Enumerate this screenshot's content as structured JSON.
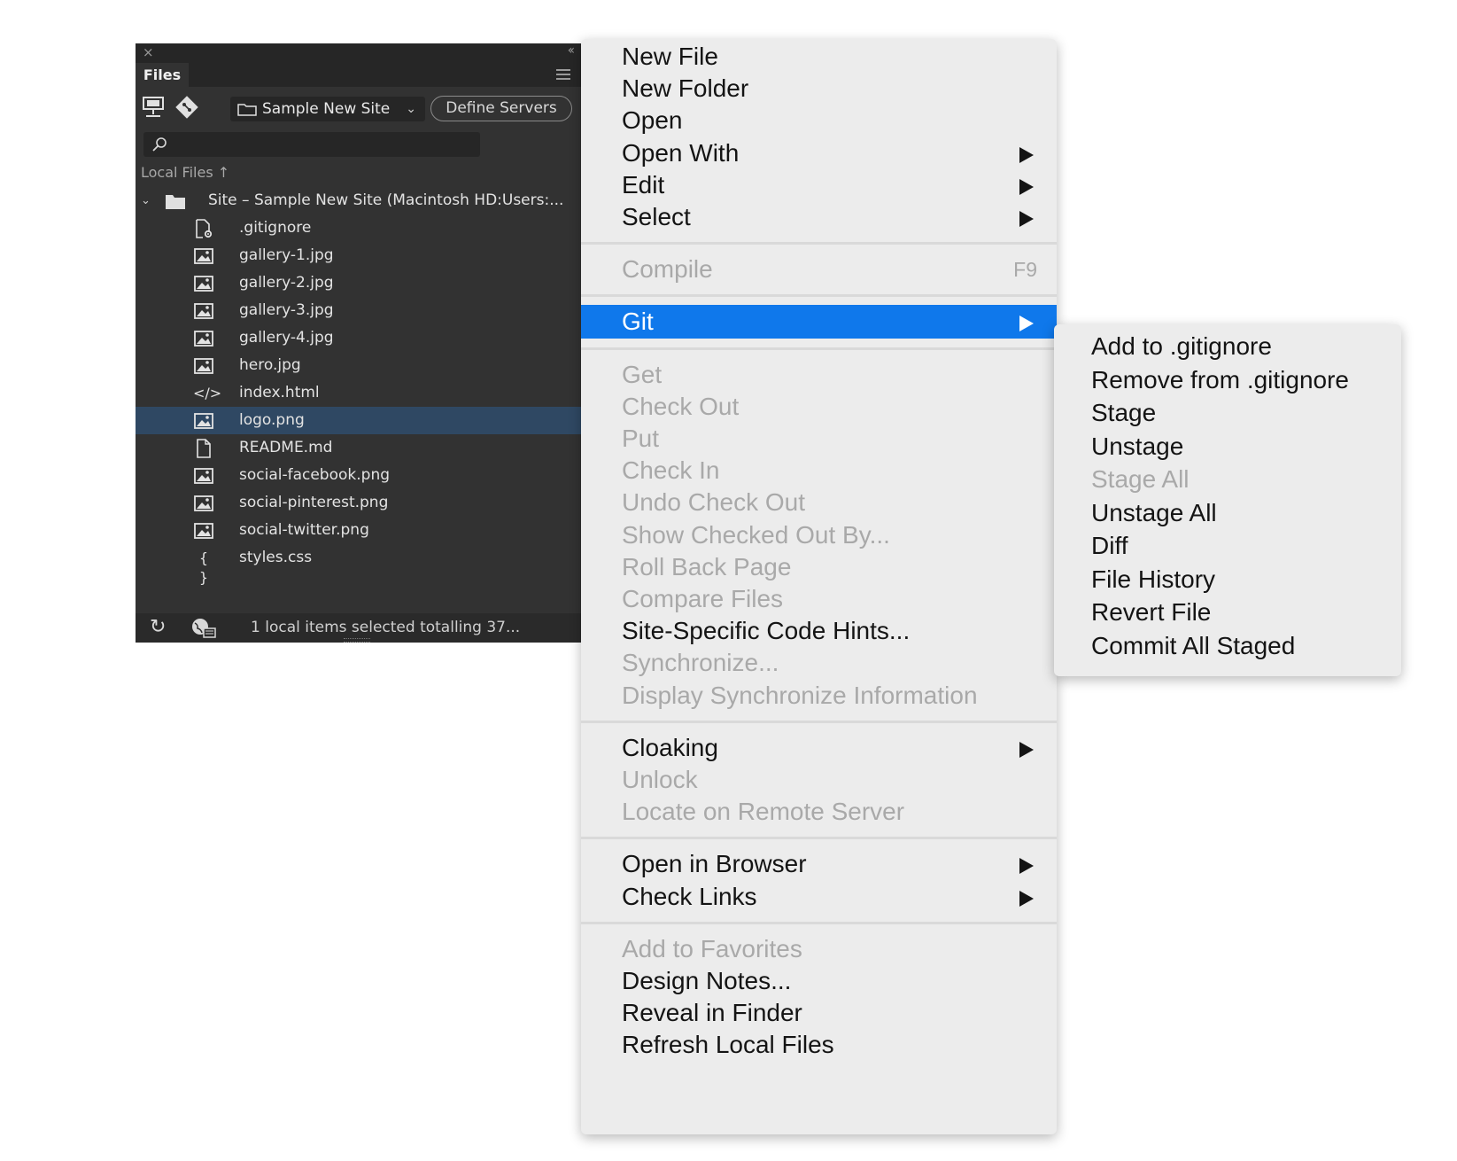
{
  "files_panel": {
    "close_glyph": "×",
    "collapse_glyph": "‹‹",
    "tab_label": "Files",
    "site_name": "Sample New Site",
    "define_servers_label": "Define Servers",
    "search_placeholder": "",
    "local_files_label": "Local Files",
    "root_label": "Site – Sample New Site (Macintosh HD:Users:...",
    "files": [
      {
        "name": ".gitignore",
        "icon": "file-gear-icon"
      },
      {
        "name": "gallery-1.jpg",
        "icon": "image-icon"
      },
      {
        "name": "gallery-2.jpg",
        "icon": "image-icon"
      },
      {
        "name": "gallery-3.jpg",
        "icon": "image-icon"
      },
      {
        "name": "gallery-4.jpg",
        "icon": "image-icon"
      },
      {
        "name": "hero.jpg",
        "icon": "image-icon"
      },
      {
        "name": "index.html",
        "icon": "code-icon"
      },
      {
        "name": "logo.png",
        "icon": "image-icon",
        "selected": true
      },
      {
        "name": "README.md",
        "icon": "document-icon"
      },
      {
        "name": "social-facebook.png",
        "icon": "image-icon"
      },
      {
        "name": "social-pinterest.png",
        "icon": "image-icon"
      },
      {
        "name": "social-twitter.png",
        "icon": "image-icon"
      },
      {
        "name": "styles.css",
        "icon": "braces-icon"
      }
    ],
    "status_text": "1 local items selected totalling 37..."
  },
  "context_menu": {
    "items": [
      {
        "label": "New File",
        "enabled": true
      },
      {
        "label": "New Folder",
        "enabled": true
      },
      {
        "label": "Open",
        "enabled": true
      },
      {
        "label": "Open With",
        "enabled": true,
        "submenu": true
      },
      {
        "label": "Edit",
        "enabled": true,
        "submenu": true
      },
      {
        "label": "Select",
        "enabled": true,
        "submenu": true
      },
      {
        "label": "Compile",
        "enabled": false,
        "shortcut": "F9"
      },
      {
        "label": "Git",
        "enabled": true,
        "submenu": true,
        "highlighted": true
      },
      {
        "label": "Get",
        "enabled": false
      },
      {
        "label": "Check Out",
        "enabled": false
      },
      {
        "label": "Put",
        "enabled": false
      },
      {
        "label": "Check In",
        "enabled": false
      },
      {
        "label": "Undo Check Out",
        "enabled": false
      },
      {
        "label": "Show Checked Out By...",
        "enabled": false
      },
      {
        "label": "Roll Back Page",
        "enabled": false
      },
      {
        "label": "Compare Files",
        "enabled": false
      },
      {
        "label": "Site-Specific Code Hints...",
        "enabled": true
      },
      {
        "label": "Synchronize...",
        "enabled": false
      },
      {
        "label": "Display Synchronize Information",
        "enabled": false
      },
      {
        "label": "Cloaking",
        "enabled": true,
        "submenu": true
      },
      {
        "label": "Unlock",
        "enabled": false
      },
      {
        "label": "Locate on Remote Server",
        "enabled": false
      },
      {
        "label": "Open in Browser",
        "enabled": true,
        "submenu": true
      },
      {
        "label": "Check Links",
        "enabled": true,
        "submenu": true
      },
      {
        "label": "Add to Favorites",
        "enabled": false
      },
      {
        "label": "Design Notes...",
        "enabled": true
      },
      {
        "label": "Reveal in Finder",
        "enabled": true
      },
      {
        "label": "Refresh Local Files",
        "enabled": true
      }
    ]
  },
  "git_submenu": {
    "items": [
      {
        "label": "Add to .gitignore",
        "enabled": true
      },
      {
        "label": "Remove from .gitignore",
        "enabled": true
      },
      {
        "label": "Stage",
        "enabled": true
      },
      {
        "label": "Unstage",
        "enabled": true
      },
      {
        "label": "Stage All",
        "enabled": false
      },
      {
        "label": "Unstage All",
        "enabled": true
      },
      {
        "label": "Diff",
        "enabled": true
      },
      {
        "label": "File History",
        "enabled": true
      },
      {
        "label": "Revert File",
        "enabled": true
      },
      {
        "label": "Commit All Staged",
        "enabled": true
      }
    ]
  },
  "colors": {
    "panel_bg": "#323232",
    "selection_bg": "#2f4863",
    "menu_bg": "#ececec",
    "menu_highlight": "#0f78eb",
    "disabled_text": "#a9a9a9"
  }
}
